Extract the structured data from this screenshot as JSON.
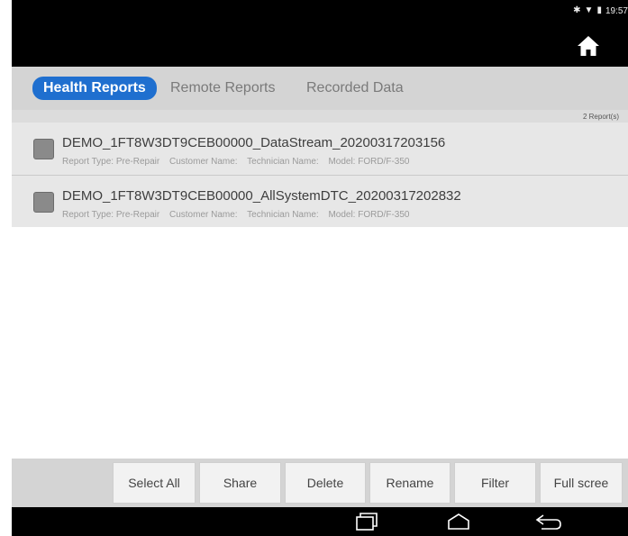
{
  "status": {
    "time": "19:57"
  },
  "tabs": [
    {
      "label": "Health Reports",
      "active": true
    },
    {
      "label": "Remote Reports",
      "active": false
    },
    {
      "label": "Recorded Data",
      "active": false
    }
  ],
  "report_count": "2 Report(s)",
  "reports": [
    {
      "title": "DEMO_1FT8W3DT9CEB00000_DataStream_20200317203156",
      "report_type": "Report Type: Pre-Repair",
      "customer": "Customer Name:",
      "technician": "Technician Name:",
      "model": "Model: FORD/F-350",
      "checked": false
    },
    {
      "title": "DEMO_1FT8W3DT9CEB00000_AllSystemDTC_20200317202832",
      "report_type": "Report Type: Pre-Repair",
      "customer": "Customer Name:",
      "technician": "Technician Name:",
      "model": "Model: FORD/F-350",
      "checked": false
    }
  ],
  "buttons": {
    "select_all": "Select All",
    "share": "Share",
    "delete": "Delete",
    "rename": "Rename",
    "filter": "Filter",
    "full_screen": "Full scree"
  },
  "icons": {
    "home": "home-icon",
    "bluetooth": "bluetooth-icon",
    "wifi": "wifi-icon",
    "battery": "battery-icon",
    "recent": "recent-apps-icon",
    "nav_home": "nav-home-icon",
    "back": "back-icon"
  },
  "colors": {
    "active_tab": "#1f6fcf",
    "tab_bar": "#d4d4d4",
    "row_bg": "#e7e7e7",
    "checkbox": "#8a8a8a",
    "bars": "#000000"
  }
}
